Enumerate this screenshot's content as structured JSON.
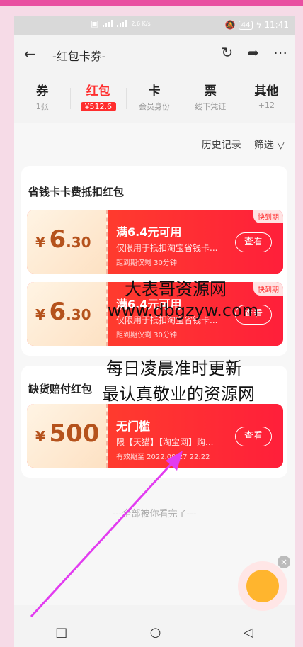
{
  "status": {
    "speed": "2.6\nK/s",
    "battery": "44",
    "time": "11:41"
  },
  "nav": {
    "title": "-红包卡券-"
  },
  "tabs": [
    {
      "title": "券",
      "sub": "1张"
    },
    {
      "title": "红包",
      "sub": "¥512.6"
    },
    {
      "title": "卡",
      "sub": "会员身份"
    },
    {
      "title": "票",
      "sub": "线下凭证"
    },
    {
      "title": "其他",
      "sub": "+12"
    }
  ],
  "toolbar": {
    "history": "历史记录",
    "filter": "筛选"
  },
  "sections": [
    {
      "title": "省钱卡卡费抵扣红包",
      "coupons": [
        {
          "currency": "¥",
          "int": "6",
          "dec": ".30",
          "cond": "满6.4元可用",
          "desc": "仅限用于抵扣淘宝省钱卡...",
          "exp": "距到期仅剩 30分钟",
          "btn": "查看",
          "tag": "快到期"
        },
        {
          "currency": "¥",
          "int": "6",
          "dec": ".30",
          "cond": "满6.4元可用",
          "desc": "仅限用于抵扣淘宝省钱卡...",
          "exp": "距到期仅剩 30分钟",
          "btn": "查看",
          "tag": "快到期"
        }
      ]
    },
    {
      "title": "缺货赔付红包",
      "coupons": [
        {
          "currency": "¥",
          "int": "500",
          "dec": "",
          "cond": "无门槛",
          "desc": "限【天猫】【淘宝网】购...",
          "exp": "有效期至 2022.09.27 22:22",
          "btn": "查看",
          "tag": ""
        }
      ]
    }
  ],
  "bottom_note": "---全部被你看完了---",
  "watermark": {
    "line1": "大表哥资源网",
    "line2": "www.dbgzyw.com",
    "line3": "每日凌晨准时更新",
    "line4": "最认真敬业的资源网"
  },
  "colors": {
    "accent": "#ff2d2d",
    "arrow": "#e23cf0"
  }
}
